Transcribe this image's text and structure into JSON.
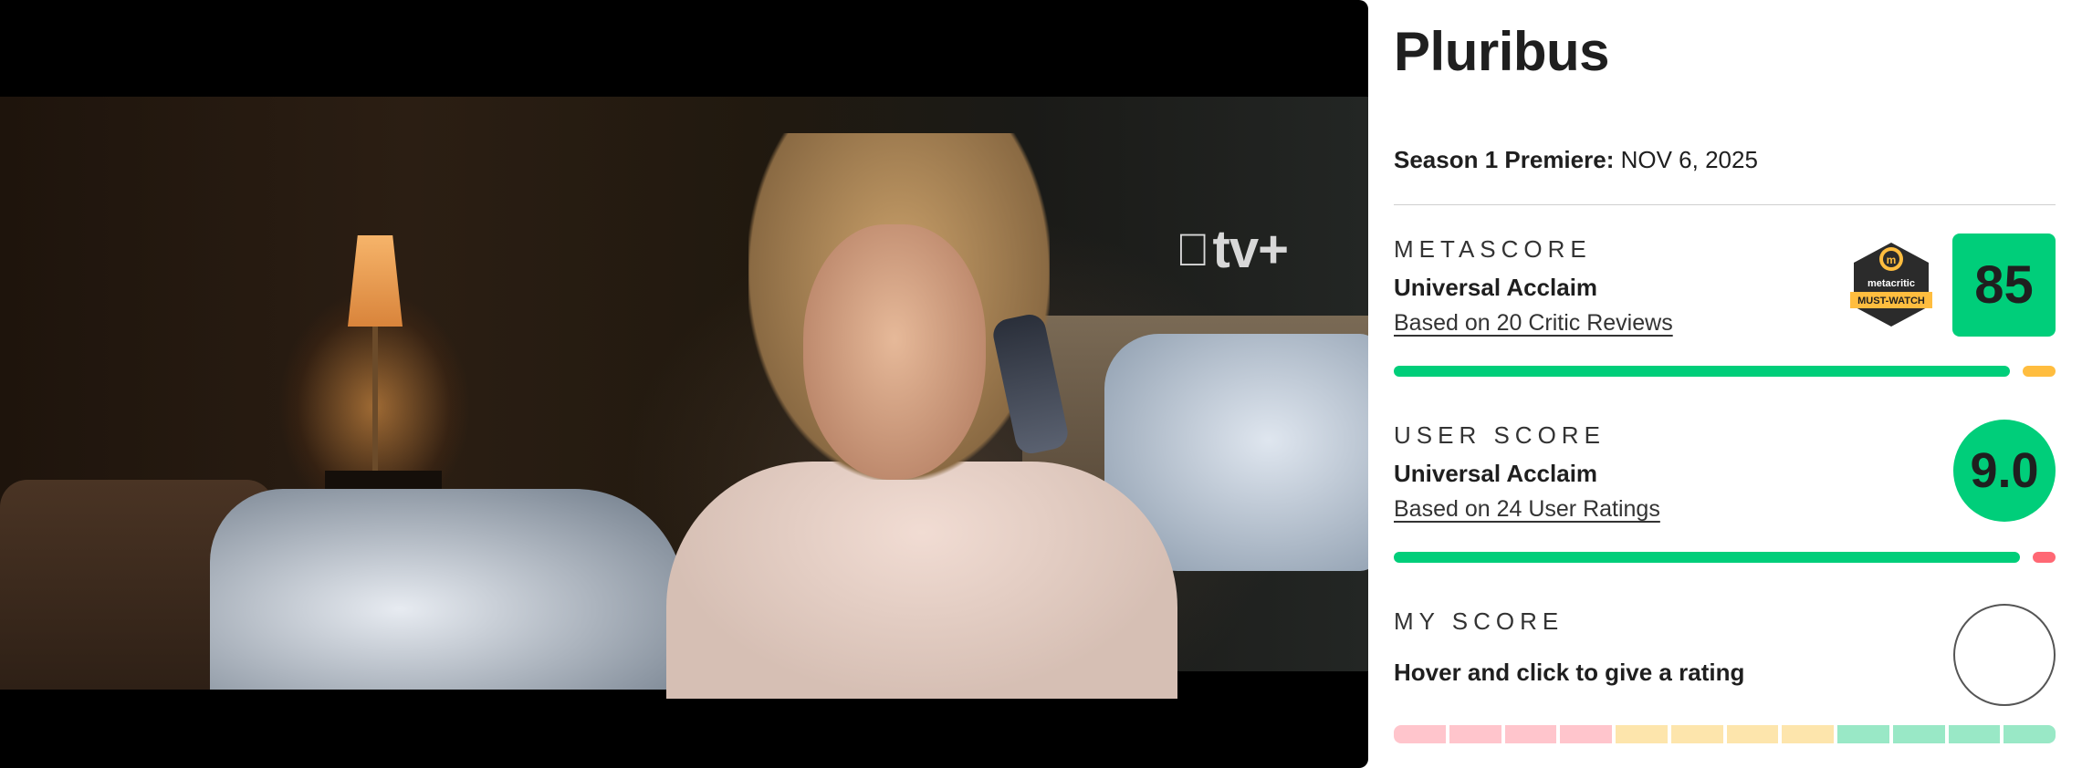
{
  "video": {
    "brand": "tv+"
  },
  "show": {
    "title": "Pluribus",
    "premiere_label": "Season 1 Premiere:",
    "premiere_date": "NOV 6, 2025"
  },
  "metascore": {
    "label": "METASCORE",
    "verdict": "Universal Acclaim",
    "link": "Based on 20 Critic Reviews",
    "score": "85",
    "badge_top": "metacritic",
    "badge_bottom": "MUST-WATCH",
    "positive_fraction": 0.95,
    "colors": {
      "positive": "#00ce7a",
      "mixed": "#ffbd3f",
      "negative": "#ff6874"
    }
  },
  "user_score": {
    "label": "USER SCORE",
    "verdict": "Universal Acclaim",
    "link": "Based on 24 User Ratings",
    "score": "9.0",
    "positive_fraction": 0.965
  },
  "my_score": {
    "label": "MY SCORE",
    "prompt": "Hover and click to give a rating",
    "segment_colors": [
      "#ffc5cc",
      "#ffc5cc",
      "#ffc5cc",
      "#ffc5cc",
      "#fde5ac",
      "#fde5ac",
      "#fde5ac",
      "#fde5ac",
      "#99e8c6",
      "#99e8c6",
      "#99e8c6",
      "#99e8c6"
    ]
  }
}
